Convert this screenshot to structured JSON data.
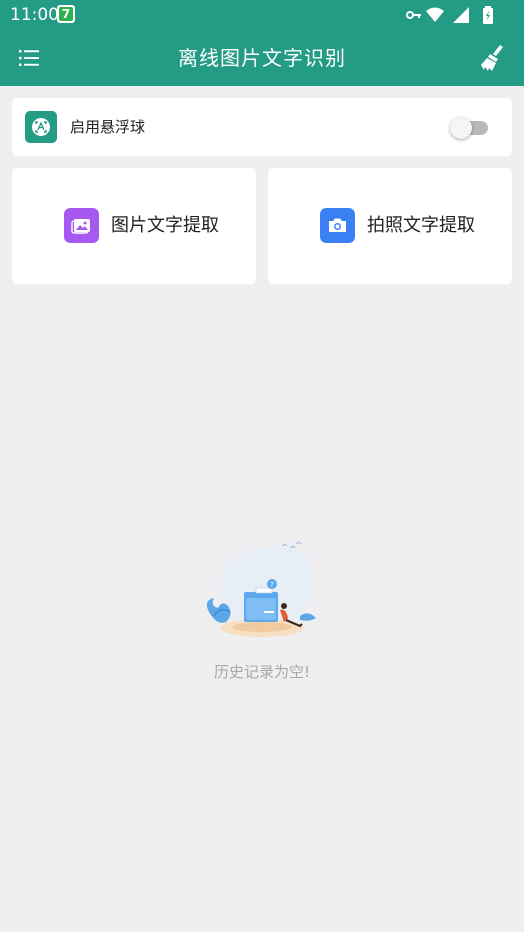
{
  "status_bar": {
    "time": "11:00",
    "badge": "7",
    "icons": [
      "vpn-key-icon",
      "wifi-icon",
      "signal-icon",
      "battery-icon"
    ]
  },
  "app_bar": {
    "title": "离线图片文字识别",
    "menu_icon": "menu-icon",
    "action_icon": "broom-icon",
    "color": "#239b85"
  },
  "float_ball": {
    "label": "启用悬浮球",
    "enabled": false
  },
  "actions": [
    {
      "label": "图片文字提取",
      "icon": "image-icon",
      "color": "#a758f0"
    },
    {
      "label": "拍照文字提取",
      "icon": "camera-icon",
      "color": "#3b7ff5"
    }
  ],
  "history": {
    "empty_text": "历史记录为空!"
  }
}
